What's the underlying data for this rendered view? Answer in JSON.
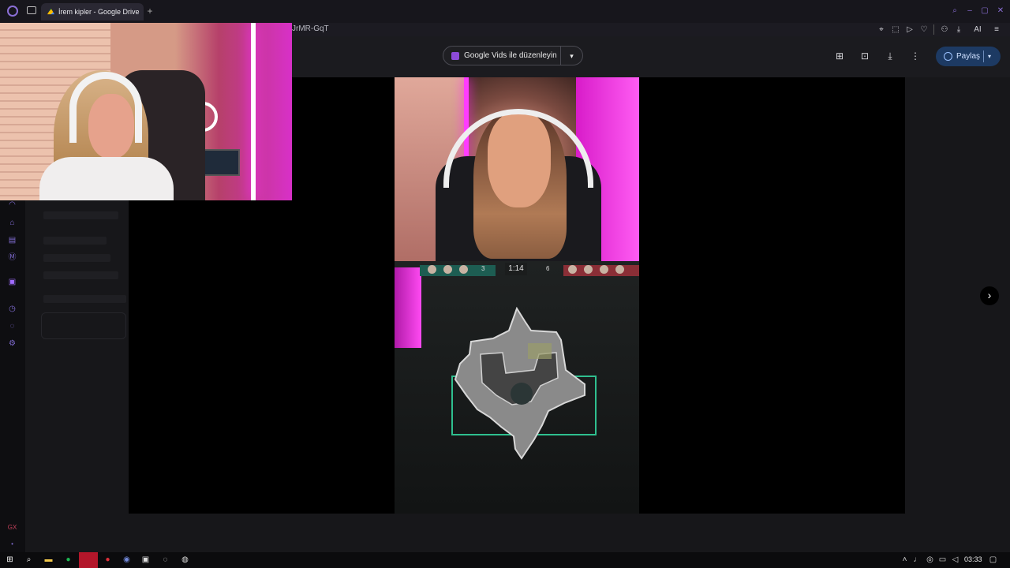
{
  "browser": {
    "tab_title": "İrem kipler - Google Drive",
    "new_tab": "+",
    "url_fragment": "JrMR-GqT",
    "ai_label": "AI"
  },
  "toolbar": {
    "vids_label": "Google Vids ile düzenleyin",
    "vids_dropdown": "▾",
    "share_label": "Paylaş",
    "share_dropdown": "▾"
  },
  "game": {
    "timer": "1:14",
    "score_left": "3",
    "score_right": "6"
  },
  "preview": {
    "next_glyph": "›"
  },
  "taskbar": {
    "time": "03:33"
  },
  "colors": {
    "share_bg": "#1d3a63",
    "opera_accent": "#7f6bd0",
    "hud_team_left": "#1d5d52",
    "hud_team_right": "#8a2e36",
    "minimap_boundary": "#2fbf8f"
  }
}
